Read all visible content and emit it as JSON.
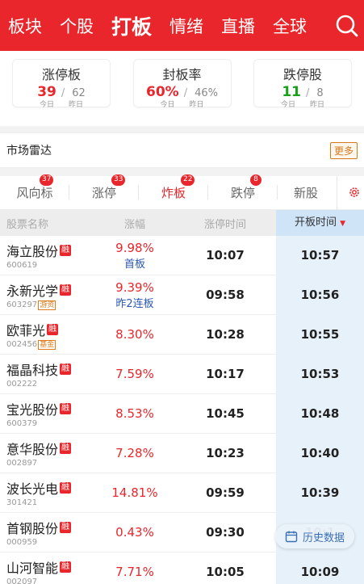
{
  "topbar": {
    "tabs": [
      "板块",
      "个股",
      "打板",
      "情绪",
      "直播",
      "全球"
    ],
    "active": "打板"
  },
  "stats": [
    {
      "title": "涨停板",
      "today": "39",
      "yesterday": "62",
      "today_label": "今日",
      "yesterday_label": "昨日",
      "color": "#e8262b"
    },
    {
      "title": "封板率",
      "today": "60%",
      "yesterday": "46%",
      "today_label": "今日",
      "yesterday_label": "昨日",
      "color": "#e8262b"
    },
    {
      "title": "跌停股",
      "today": "11",
      "yesterday": "8",
      "today_label": "今日",
      "yesterday_label": "昨日",
      "color": "#1aa01a"
    }
  ],
  "radar": {
    "title": "市场雷达",
    "more": "更多"
  },
  "subtabs": [
    {
      "label": "风向标",
      "badge": "37"
    },
    {
      "label": "涨停",
      "badge": "33"
    },
    {
      "label": "炸板",
      "badge": "22"
    },
    {
      "label": "跌停",
      "badge": "8"
    },
    {
      "label": "新股",
      "badge": ""
    }
  ],
  "subtabs_active": "炸板",
  "table": {
    "headers": {
      "name": "股票名称",
      "rise": "涨幅",
      "time": "涨停时间",
      "open": "开板时间",
      "sort_arrow": "▼"
    },
    "rows": [
      {
        "name": "海立股份",
        "code": "600619",
        "tag": "",
        "rise": "9.98%",
        "sub": "首板",
        "time": "10:07",
        "open": "10:57"
      },
      {
        "name": "永新光学",
        "code": "603297",
        "tag": "游资",
        "rise": "9.39%",
        "sub": "昨2连板",
        "time": "09:58",
        "open": "10:56"
      },
      {
        "name": "欧菲光",
        "code": "002456",
        "tag": "基金",
        "rise": "8.30%",
        "sub": "",
        "time": "10:28",
        "open": "10:55"
      },
      {
        "name": "福晶科技",
        "code": "002222",
        "tag": "",
        "rise": "7.59%",
        "sub": "",
        "time": "10:17",
        "open": "10:53"
      },
      {
        "name": "宝光股份",
        "code": "600379",
        "tag": "",
        "rise": "8.53%",
        "sub": "",
        "time": "10:45",
        "open": "10:48"
      },
      {
        "name": "意华股份",
        "code": "002897",
        "tag": "",
        "rise": "7.28%",
        "sub": "",
        "time": "10:23",
        "open": "10:40"
      },
      {
        "name": "波长光电",
        "code": "301421",
        "tag": "",
        "rise": "14.81%",
        "sub": "",
        "time": "09:59",
        "open": "10:39"
      },
      {
        "name": "首钢股份",
        "code": "000959",
        "tag": "",
        "rise": "0.43%",
        "sub": "",
        "time": "09:30",
        "open": "10:1"
      },
      {
        "name": "山河智能",
        "code": "002097",
        "tag": "",
        "rise": "7.71%",
        "sub": "",
        "time": "10:05",
        "open": "10:09"
      }
    ],
    "rong_label": "融"
  },
  "history_button": "历史数据"
}
